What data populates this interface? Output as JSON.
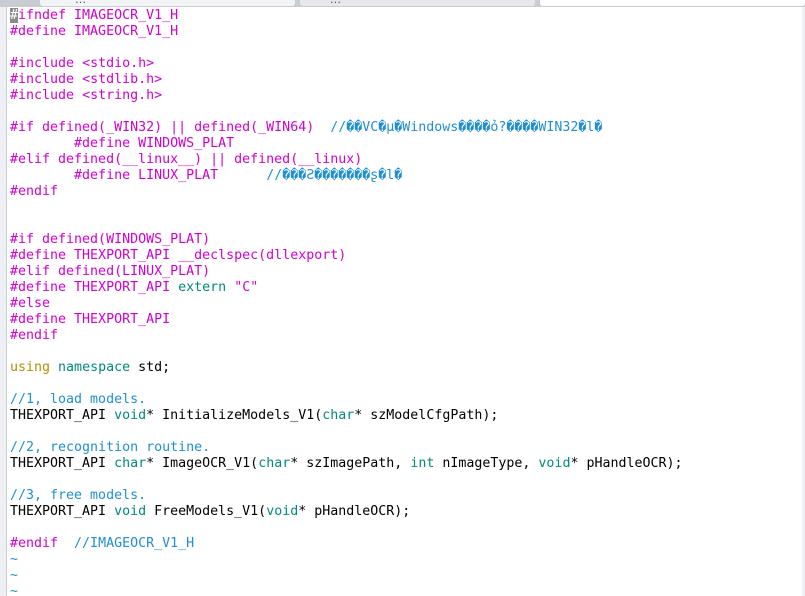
{
  "colors": {
    "preproc": "#d000d0",
    "comment": "#1f8fd0",
    "type": "#008a7a",
    "keyword": "#b88a00",
    "string": "#d000d0",
    "plain": "#000000",
    "tilde": "#1f8fd0"
  },
  "tabs": [
    {
      "label": "…"
    },
    {
      "label": "…"
    }
  ],
  "editor": {
    "lines": [
      [
        [
          "#",
          "cursor"
        ],
        [
          "ifndef IMAGEOCR_V1_H",
          "preproc"
        ]
      ],
      [
        [
          "#define IMAGEOCR_V1_H",
          "preproc"
        ]
      ],
      [],
      [
        [
          "#include ",
          "preproc"
        ],
        [
          "<stdio.h>",
          "string"
        ]
      ],
      [
        [
          "#include ",
          "preproc"
        ],
        [
          "<stdlib.h>",
          "string"
        ]
      ],
      [
        [
          "#include ",
          "preproc"
        ],
        [
          "<string.h>",
          "string"
        ]
      ],
      [],
      [
        [
          "#if defined(_WIN32) || defined(_WIN64)  ",
          "preproc"
        ],
        [
          "//��VC�µ�Windows����ỏ?����WIN32�l�",
          "comment"
        ]
      ],
      [
        [
          "        #define WINDOWS_PLAT",
          "preproc"
        ]
      ],
      [
        [
          "#elif defined(__linux__) || defined(__linux)",
          "preproc"
        ]
      ],
      [
        [
          "        #define LINUX_PLAT      ",
          "preproc"
        ],
        [
          "//���Ƨ�������ʂ�l�",
          "comment"
        ]
      ],
      [
        [
          "#endif",
          "preproc"
        ]
      ],
      [],
      [],
      [
        [
          "#if defined(WINDOWS_PLAT)",
          "preproc"
        ]
      ],
      [
        [
          "#define THEXPORT_API __declspec(dllexport)",
          "preproc"
        ]
      ],
      [
        [
          "#elif defined(LINUX_PLAT)",
          "preproc"
        ]
      ],
      [
        [
          "#define THEXPORT_API ",
          "preproc"
        ],
        [
          "extern",
          "type"
        ],
        [
          " ",
          "plain"
        ],
        [
          "\"C\"",
          "string"
        ]
      ],
      [
        [
          "#else",
          "preproc"
        ]
      ],
      [
        [
          "#define THEXPORT_API",
          "preproc"
        ]
      ],
      [
        [
          "#endif",
          "preproc"
        ]
      ],
      [],
      [
        [
          "using",
          "keyword"
        ],
        [
          " ",
          "plain"
        ],
        [
          "namespace",
          "type"
        ],
        [
          " std;",
          "plain"
        ]
      ],
      [],
      [
        [
          "//1, load models.",
          "comment"
        ]
      ],
      [
        [
          "THEXPORT_API ",
          "plain"
        ],
        [
          "void",
          "type"
        ],
        [
          "* InitializeModels_V1(",
          "plain"
        ],
        [
          "char",
          "type"
        ],
        [
          "* szModelCfgPath);",
          "plain"
        ]
      ],
      [],
      [
        [
          "//2, recognition routine.",
          "comment"
        ]
      ],
      [
        [
          "THEXPORT_API ",
          "plain"
        ],
        [
          "char",
          "type"
        ],
        [
          "* ImageOCR_V1(",
          "plain"
        ],
        [
          "char",
          "type"
        ],
        [
          "* szImagePath, ",
          "plain"
        ],
        [
          "int",
          "type"
        ],
        [
          " nImageType, ",
          "plain"
        ],
        [
          "void",
          "type"
        ],
        [
          "* pHandleOCR);",
          "plain"
        ]
      ],
      [],
      [
        [
          "//3, free models.",
          "comment"
        ]
      ],
      [
        [
          "THEXPORT_API ",
          "plain"
        ],
        [
          "void",
          "type"
        ],
        [
          " FreeModels_V1(",
          "plain"
        ],
        [
          "void",
          "type"
        ],
        [
          "* pHandleOCR);",
          "plain"
        ]
      ],
      [],
      [
        [
          "#endif  ",
          "preproc"
        ],
        [
          "//IMAGEOCR_V1_H",
          "comment"
        ]
      ],
      [
        [
          "~",
          "tilde"
        ]
      ],
      [
        [
          "~",
          "tilde"
        ]
      ],
      [
        [
          "~",
          "tilde"
        ]
      ]
    ]
  }
}
